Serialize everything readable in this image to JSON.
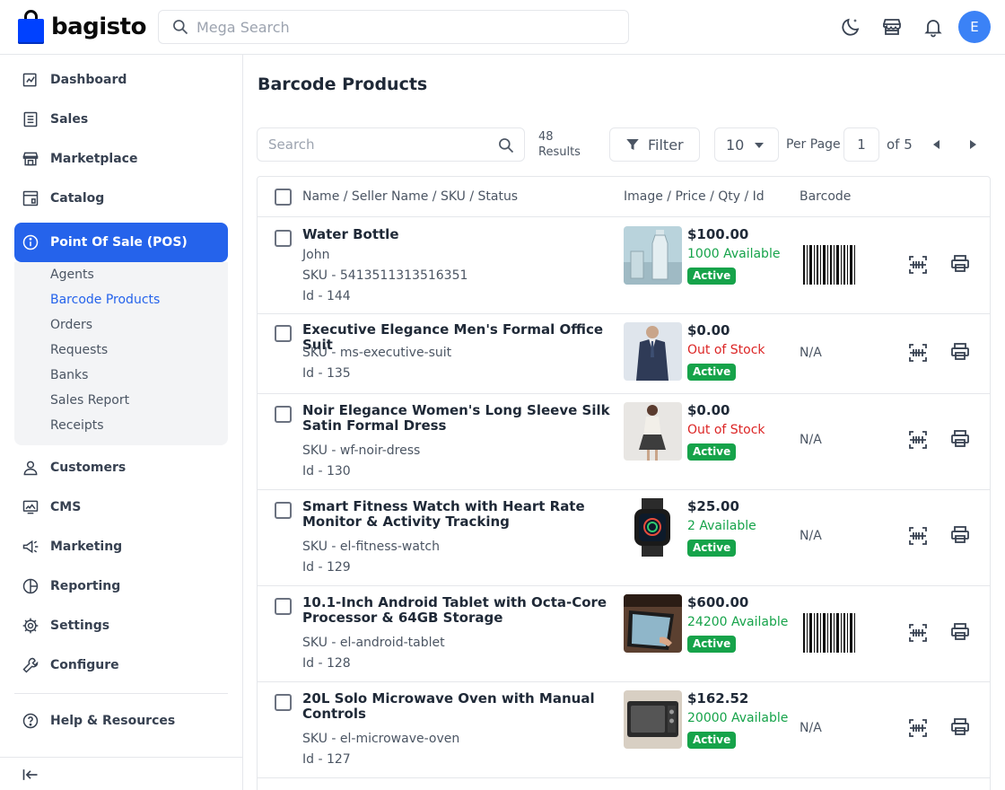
{
  "app": {
    "name": "bagisto",
    "brand_color": "#2563eb"
  },
  "header": {
    "search_placeholder": "Mega Search",
    "user_initial": "E",
    "icons": [
      "moon-icon",
      "store-icon",
      "bell-icon"
    ]
  },
  "sidebar": {
    "items": [
      {
        "label": "Dashboard",
        "icon": "dashboard-icon"
      },
      {
        "label": "Sales",
        "icon": "sales-icon"
      },
      {
        "label": "Marketplace",
        "icon": "store-icon"
      },
      {
        "label": "Catalog",
        "icon": "catalog-icon"
      },
      {
        "label": "Point Of Sale (POS)",
        "icon": "info-icon",
        "active": true
      },
      {
        "label": "Customers",
        "icon": "user-icon"
      },
      {
        "label": "CMS",
        "icon": "cms-icon"
      },
      {
        "label": "Marketing",
        "icon": "megaphone-icon"
      },
      {
        "label": "Reporting",
        "icon": "pie-chart-icon"
      },
      {
        "label": "Settings",
        "icon": "gear-icon"
      },
      {
        "label": "Configure",
        "icon": "wrench-icon"
      },
      {
        "label": "Help & Resources",
        "icon": "help-icon"
      }
    ],
    "submenu": [
      "Agents",
      "Barcode Products",
      "Orders",
      "Requests",
      "Banks",
      "Sales Report",
      "Receipts"
    ],
    "active_sub": "Barcode Products"
  },
  "main": {
    "title": "Barcode Products",
    "search_placeholder": "Search",
    "results_count": "48",
    "results_label": "Results",
    "filter_label": "Filter",
    "per_page_value": "10",
    "per_page_label": "Per Page",
    "current_page": "1",
    "of_pages": "of 5",
    "columns": [
      "Name / Seller Name / SKU / Status",
      "Image / Price / Qty / Id",
      "Barcode"
    ],
    "rows": [
      {
        "name": "Water Bottle",
        "seller": "John",
        "sku": "SKU - 5413511313516351",
        "id": "Id - 144",
        "price": "$100.00",
        "qty": "1000 Available",
        "in_stock": true,
        "status": "Active",
        "barcode": "",
        "image": "water-bottle"
      },
      {
        "name": "Executive Elegance Men's Formal Office Suit",
        "seller": "",
        "sku": "SKU - ms-executive-suit",
        "id": "Id - 135",
        "price": "$0.00",
        "qty": "Out of Stock",
        "in_stock": false,
        "status": "Active",
        "barcode": "N/A",
        "image": "suit"
      },
      {
        "name": "Noir Elegance Women's Long Sleeve Silk Satin Formal Dress",
        "seller": "",
        "sku": "SKU - wf-noir-dress",
        "id": "Id - 130",
        "price": "$0.00",
        "qty": "Out of Stock",
        "in_stock": false,
        "status": "Active",
        "barcode": "N/A",
        "image": "dress"
      },
      {
        "name": "Smart Fitness Watch with Heart Rate Monitor & Activity Tracking",
        "seller": "",
        "sku": "SKU - el-fitness-watch",
        "id": "Id - 129",
        "price": "$25.00",
        "qty": "2 Available",
        "in_stock": true,
        "status": "Active",
        "barcode": "N/A",
        "image": "watch"
      },
      {
        "name": "10.1-Inch Android Tablet with Octa-Core Processor & 64GB Storage",
        "seller": "",
        "sku": "SKU - el-android-tablet",
        "id": "Id - 128",
        "price": "$600.00",
        "qty": "24200 Available",
        "in_stock": true,
        "status": "Active",
        "barcode": "",
        "image": "tablet"
      },
      {
        "name": "20L Solo Microwave Oven with Manual Controls",
        "seller": "",
        "sku": "SKU - el-microwave-oven",
        "id": "Id - 127",
        "price": "$162.52",
        "qty": "20000 Available",
        "in_stock": true,
        "status": "Active",
        "barcode": "N/A",
        "image": "microwave"
      }
    ]
  }
}
